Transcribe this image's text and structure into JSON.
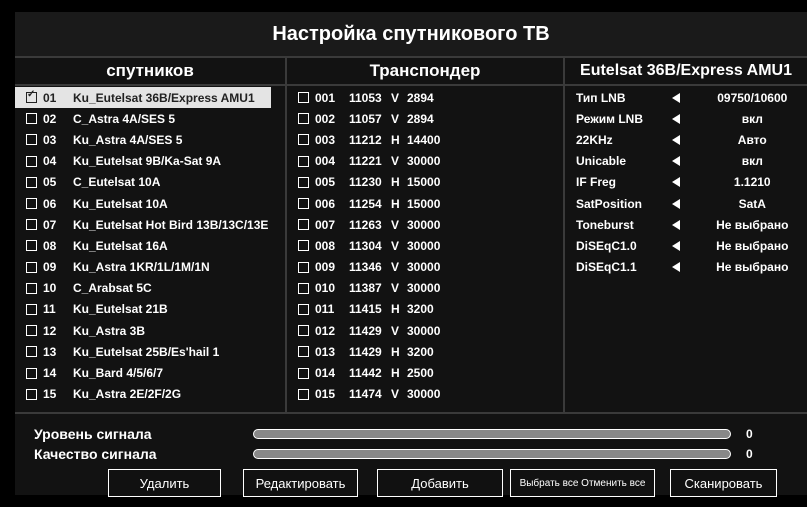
{
  "title": "Настройка спутникового ТВ",
  "satellites": {
    "header": "спутников",
    "items": [
      {
        "num": "01",
        "name": "Ku_Eutelsat 36B/Express AMU1",
        "checked": true,
        "selected": true
      },
      {
        "num": "02",
        "name": "C_Astra 4A/SES 5",
        "checked": false,
        "selected": false
      },
      {
        "num": "03",
        "name": "Ku_Astra 4A/SES 5",
        "checked": false,
        "selected": false
      },
      {
        "num": "04",
        "name": "Ku_Eutelsat 9B/Ka-Sat 9A",
        "checked": false,
        "selected": false
      },
      {
        "num": "05",
        "name": "C_Eutelsat 10A",
        "checked": false,
        "selected": false
      },
      {
        "num": "06",
        "name": "Ku_Eutelsat 10A",
        "checked": false,
        "selected": false
      },
      {
        "num": "07",
        "name": "Ku_Eutelsat Hot Bird 13B/13C/13E",
        "checked": false,
        "selected": false
      },
      {
        "num": "08",
        "name": "Ku_Eutelsat 16A",
        "checked": false,
        "selected": false
      },
      {
        "num": "09",
        "name": "Ku_Astra 1KR/1L/1M/1N",
        "checked": false,
        "selected": false
      },
      {
        "num": "10",
        "name": "C_Arabsat 5C",
        "checked": false,
        "selected": false
      },
      {
        "num": "11",
        "name": "Ku_Eutelsat 21B",
        "checked": false,
        "selected": false
      },
      {
        "num": "12",
        "name": "Ku_Astra 3B",
        "checked": false,
        "selected": false
      },
      {
        "num": "13",
        "name": "Ku_Eutelsat 25B/Es'hail 1",
        "checked": false,
        "selected": false
      },
      {
        "num": "14",
        "name": "Ku_Bard 4/5/6/7",
        "checked": false,
        "selected": false
      },
      {
        "num": "15",
        "name": "Ku_Astra 2E/2F/2G",
        "checked": false,
        "selected": false
      }
    ]
  },
  "transponders": {
    "header": "Транспондер",
    "items": [
      {
        "num": "001",
        "freq": "11053",
        "pol": "V",
        "sr": "2894"
      },
      {
        "num": "002",
        "freq": "11057",
        "pol": "V",
        "sr": "2894"
      },
      {
        "num": "003",
        "freq": "11212",
        "pol": "H",
        "sr": "14400"
      },
      {
        "num": "004",
        "freq": "11221",
        "pol": "V",
        "sr": "30000"
      },
      {
        "num": "005",
        "freq": "11230",
        "pol": "H",
        "sr": "15000"
      },
      {
        "num": "006",
        "freq": "11254",
        "pol": "H",
        "sr": "15000"
      },
      {
        "num": "007",
        "freq": "11263",
        "pol": "V",
        "sr": "30000"
      },
      {
        "num": "008",
        "freq": "11304",
        "pol": "V",
        "sr": "30000"
      },
      {
        "num": "009",
        "freq": "11346",
        "pol": "V",
        "sr": "30000"
      },
      {
        "num": "010",
        "freq": "11387",
        "pol": "V",
        "sr": "30000"
      },
      {
        "num": "011",
        "freq": "11415",
        "pol": "H",
        "sr": "3200"
      },
      {
        "num": "012",
        "freq": "11429",
        "pol": "V",
        "sr": "30000"
      },
      {
        "num": "013",
        "freq": "11429",
        "pol": "H",
        "sr": "3200"
      },
      {
        "num": "014",
        "freq": "11442",
        "pol": "H",
        "sr": "2500"
      },
      {
        "num": "015",
        "freq": "11474",
        "pol": "V",
        "sr": "30000"
      }
    ]
  },
  "config": {
    "header": "Eutelsat 36B/Express AMU1",
    "items": [
      {
        "label": "Тип LNB",
        "value": "09750/10600"
      },
      {
        "label": "Режим LNB",
        "value": "вкл"
      },
      {
        "label": "22KHz",
        "value": "Авто"
      },
      {
        "label": "Unicable",
        "value": "вкл"
      },
      {
        "label": "IF Freg",
        "value": "1.1210"
      },
      {
        "label": "SatPosition",
        "value": "SatA"
      },
      {
        "label": "Toneburst",
        "value": "Не выбрано"
      },
      {
        "label": "DiSEqC1.0",
        "value": "Не выбрано"
      },
      {
        "label": "DiSEqC1.1",
        "value": "Не выбрано"
      }
    ]
  },
  "signal": {
    "level_label": "Уровень сигнала",
    "level_value": "0",
    "quality_label": "Качество сигнала",
    "quality_value": "0"
  },
  "buttons": {
    "delete": "Удалить",
    "edit": "Редактировать",
    "add": "Добавить",
    "select_all": "Выбрать все Отменить все",
    "scan": "Сканировать"
  }
}
